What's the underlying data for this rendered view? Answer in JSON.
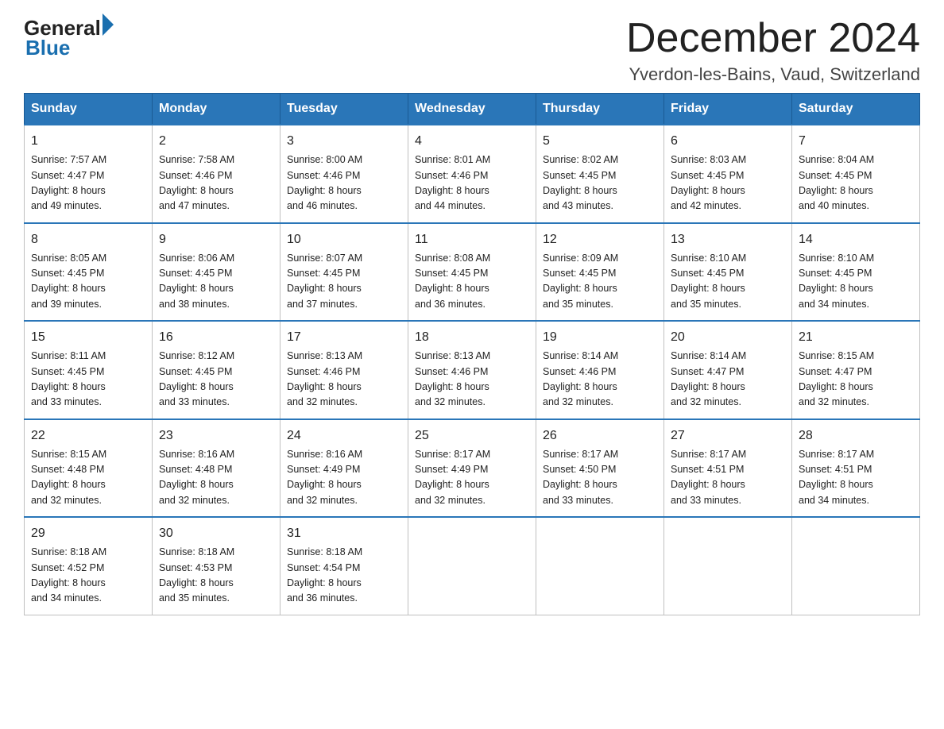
{
  "header": {
    "logo": {
      "general": "General",
      "triangle": "",
      "blue": "Blue"
    },
    "title": "December 2024",
    "location": "Yverdon-les-Bains, Vaud, Switzerland"
  },
  "days_of_week": [
    "Sunday",
    "Monday",
    "Tuesday",
    "Wednesday",
    "Thursday",
    "Friday",
    "Saturday"
  ],
  "weeks": [
    [
      {
        "day": "1",
        "sunrise": "7:57 AM",
        "sunset": "4:47 PM",
        "daylight": "8 hours and 49 minutes."
      },
      {
        "day": "2",
        "sunrise": "7:58 AM",
        "sunset": "4:46 PM",
        "daylight": "8 hours and 47 minutes."
      },
      {
        "day": "3",
        "sunrise": "8:00 AM",
        "sunset": "4:46 PM",
        "daylight": "8 hours and 46 minutes."
      },
      {
        "day": "4",
        "sunrise": "8:01 AM",
        "sunset": "4:46 PM",
        "daylight": "8 hours and 44 minutes."
      },
      {
        "day": "5",
        "sunrise": "8:02 AM",
        "sunset": "4:45 PM",
        "daylight": "8 hours and 43 minutes."
      },
      {
        "day": "6",
        "sunrise": "8:03 AM",
        "sunset": "4:45 PM",
        "daylight": "8 hours and 42 minutes."
      },
      {
        "day": "7",
        "sunrise": "8:04 AM",
        "sunset": "4:45 PM",
        "daylight": "8 hours and 40 minutes."
      }
    ],
    [
      {
        "day": "8",
        "sunrise": "8:05 AM",
        "sunset": "4:45 PM",
        "daylight": "8 hours and 39 minutes."
      },
      {
        "day": "9",
        "sunrise": "8:06 AM",
        "sunset": "4:45 PM",
        "daylight": "8 hours and 38 minutes."
      },
      {
        "day": "10",
        "sunrise": "8:07 AM",
        "sunset": "4:45 PM",
        "daylight": "8 hours and 37 minutes."
      },
      {
        "day": "11",
        "sunrise": "8:08 AM",
        "sunset": "4:45 PM",
        "daylight": "8 hours and 36 minutes."
      },
      {
        "day": "12",
        "sunrise": "8:09 AM",
        "sunset": "4:45 PM",
        "daylight": "8 hours and 35 minutes."
      },
      {
        "day": "13",
        "sunrise": "8:10 AM",
        "sunset": "4:45 PM",
        "daylight": "8 hours and 35 minutes."
      },
      {
        "day": "14",
        "sunrise": "8:10 AM",
        "sunset": "4:45 PM",
        "daylight": "8 hours and 34 minutes."
      }
    ],
    [
      {
        "day": "15",
        "sunrise": "8:11 AM",
        "sunset": "4:45 PM",
        "daylight": "8 hours and 33 minutes."
      },
      {
        "day": "16",
        "sunrise": "8:12 AM",
        "sunset": "4:45 PM",
        "daylight": "8 hours and 33 minutes."
      },
      {
        "day": "17",
        "sunrise": "8:13 AM",
        "sunset": "4:46 PM",
        "daylight": "8 hours and 32 minutes."
      },
      {
        "day": "18",
        "sunrise": "8:13 AM",
        "sunset": "4:46 PM",
        "daylight": "8 hours and 32 minutes."
      },
      {
        "day": "19",
        "sunrise": "8:14 AM",
        "sunset": "4:46 PM",
        "daylight": "8 hours and 32 minutes."
      },
      {
        "day": "20",
        "sunrise": "8:14 AM",
        "sunset": "4:47 PM",
        "daylight": "8 hours and 32 minutes."
      },
      {
        "day": "21",
        "sunrise": "8:15 AM",
        "sunset": "4:47 PM",
        "daylight": "8 hours and 32 minutes."
      }
    ],
    [
      {
        "day": "22",
        "sunrise": "8:15 AM",
        "sunset": "4:48 PM",
        "daylight": "8 hours and 32 minutes."
      },
      {
        "day": "23",
        "sunrise": "8:16 AM",
        "sunset": "4:48 PM",
        "daylight": "8 hours and 32 minutes."
      },
      {
        "day": "24",
        "sunrise": "8:16 AM",
        "sunset": "4:49 PM",
        "daylight": "8 hours and 32 minutes."
      },
      {
        "day": "25",
        "sunrise": "8:17 AM",
        "sunset": "4:49 PM",
        "daylight": "8 hours and 32 minutes."
      },
      {
        "day": "26",
        "sunrise": "8:17 AM",
        "sunset": "4:50 PM",
        "daylight": "8 hours and 33 minutes."
      },
      {
        "day": "27",
        "sunrise": "8:17 AM",
        "sunset": "4:51 PM",
        "daylight": "8 hours and 33 minutes."
      },
      {
        "day": "28",
        "sunrise": "8:17 AM",
        "sunset": "4:51 PM",
        "daylight": "8 hours and 34 minutes."
      }
    ],
    [
      {
        "day": "29",
        "sunrise": "8:18 AM",
        "sunset": "4:52 PM",
        "daylight": "8 hours and 34 minutes."
      },
      {
        "day": "30",
        "sunrise": "8:18 AM",
        "sunset": "4:53 PM",
        "daylight": "8 hours and 35 minutes."
      },
      {
        "day": "31",
        "sunrise": "8:18 AM",
        "sunset": "4:54 PM",
        "daylight": "8 hours and 36 minutes."
      },
      null,
      null,
      null,
      null
    ]
  ],
  "labels": {
    "sunrise": "Sunrise:",
    "sunset": "Sunset:",
    "daylight": "Daylight:"
  }
}
